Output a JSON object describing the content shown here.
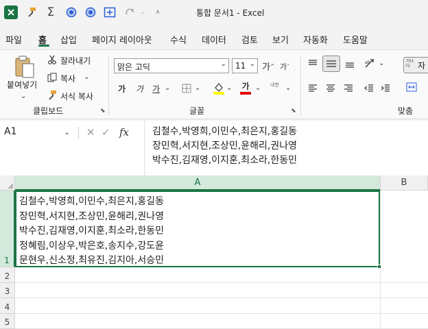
{
  "titlebar": {
    "icons": [
      "excel-app-icon",
      "format-painter-icon",
      "autosum-icon",
      "circle-icon",
      "circle-icon",
      "screen-capture-icon",
      "redo-icon",
      "customize-qat-icon"
    ],
    "title": "통합 문서1  -  Excel"
  },
  "menu": {
    "items": [
      "파일",
      "홈",
      "삽입",
      "페이지 레이아웃",
      "수식",
      "데이터",
      "검토",
      "보기",
      "자동화",
      "도움말"
    ],
    "active": "홈"
  },
  "ribbon": {
    "clipboard": {
      "paste": "붙여넣기",
      "cut": "잘라내기",
      "copy": "복사",
      "format_painter": "서식 복사",
      "label": "클립보드"
    },
    "font": {
      "font_name": "맑은 고딕",
      "font_size": "11",
      "grow": "가",
      "shrink": "가",
      "bold": "가",
      "italic": "가",
      "underline": "가",
      "fill_color": "#ffff00",
      "font_color": "#e00000",
      "font_color_label": "가",
      "phonetic": "내천",
      "label": "글꼴"
    },
    "alignment": {
      "wrap_text": "가나다",
      "wrap_suffix": "자",
      "label": "맞춤"
    }
  },
  "formula_bar": {
    "name_box": "A1",
    "cancel": "✕",
    "enter": "✓",
    "fx": "fx",
    "content": "김철수,박영희,이민수,최은지,홍길동\n장민혁,서지현,조상민,윤해리,권나영\n박수진,김재영,이지훈,최소라,한동민"
  },
  "sheet": {
    "columns": [
      "A",
      "B"
    ],
    "rows": [
      "1",
      "2",
      "3",
      "4",
      "5"
    ],
    "a1_value": "김철수,박영희,이민수,최은지,홍길동\n장민혁,서지현,조상민,윤해리,권나영\n박수진,김재영,이지훈,최소라,한동민\n정혜림,이상우,박은호,송지수,강도윤\n문현우,신소정,최유진,김지아,서승민"
  }
}
